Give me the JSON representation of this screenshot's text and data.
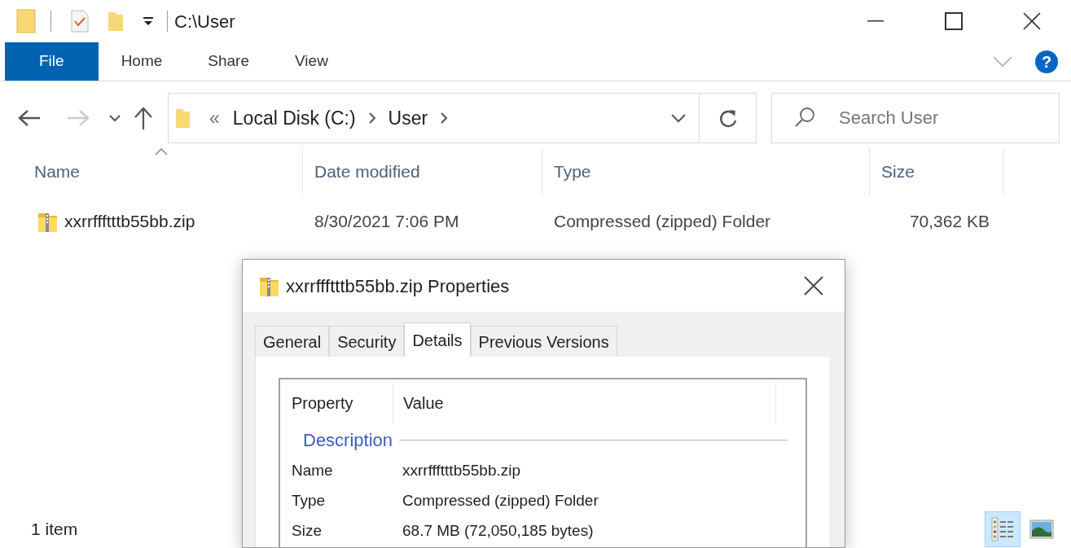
{
  "window": {
    "title": "C:\\User"
  },
  "ribbon": {
    "tabs": [
      {
        "label": "File",
        "selected": true
      },
      {
        "label": "Home",
        "selected": false
      },
      {
        "label": "Share",
        "selected": false
      },
      {
        "label": "View",
        "selected": false
      }
    ],
    "help": "?"
  },
  "address": {
    "overflow": "«",
    "crumbs": [
      "Local Disk (C:)",
      "User"
    ]
  },
  "search": {
    "placeholder": "Search User"
  },
  "table": {
    "columns": [
      {
        "label": "Name",
        "sorted": true
      },
      {
        "label": "Date modified",
        "sorted": false
      },
      {
        "label": "Type",
        "sorted": false
      },
      {
        "label": "Size",
        "sorted": false
      }
    ],
    "rows": [
      {
        "name": "xxrrffftttb55bb.zip",
        "date": "8/30/2021 7:06 PM",
        "type": "Compressed (zipped) Folder",
        "size": "70,362 KB"
      }
    ]
  },
  "status_bar": {
    "count": "1 item",
    "views": [
      {
        "kind": "details",
        "selected": true
      },
      {
        "kind": "large-icons",
        "selected": false
      }
    ]
  },
  "dialog": {
    "title": "xxrrffftttb55bb.zip Properties",
    "tabs": [
      {
        "label": "General",
        "selected": false
      },
      {
        "label": "Security",
        "selected": false
      },
      {
        "label": "Details",
        "selected": true
      },
      {
        "label": "Previous Versions",
        "selected": false
      }
    ],
    "columns": [
      "Property",
      "Value"
    ],
    "group": "Description",
    "rows": [
      {
        "property": "Name",
        "value": "xxrrffftttb55bb.zip"
      },
      {
        "property": "Type",
        "value": "Compressed (zipped) Folder"
      },
      {
        "property": "Size",
        "value": "68.7 MB (72,050,185 bytes)"
      }
    ]
  }
}
